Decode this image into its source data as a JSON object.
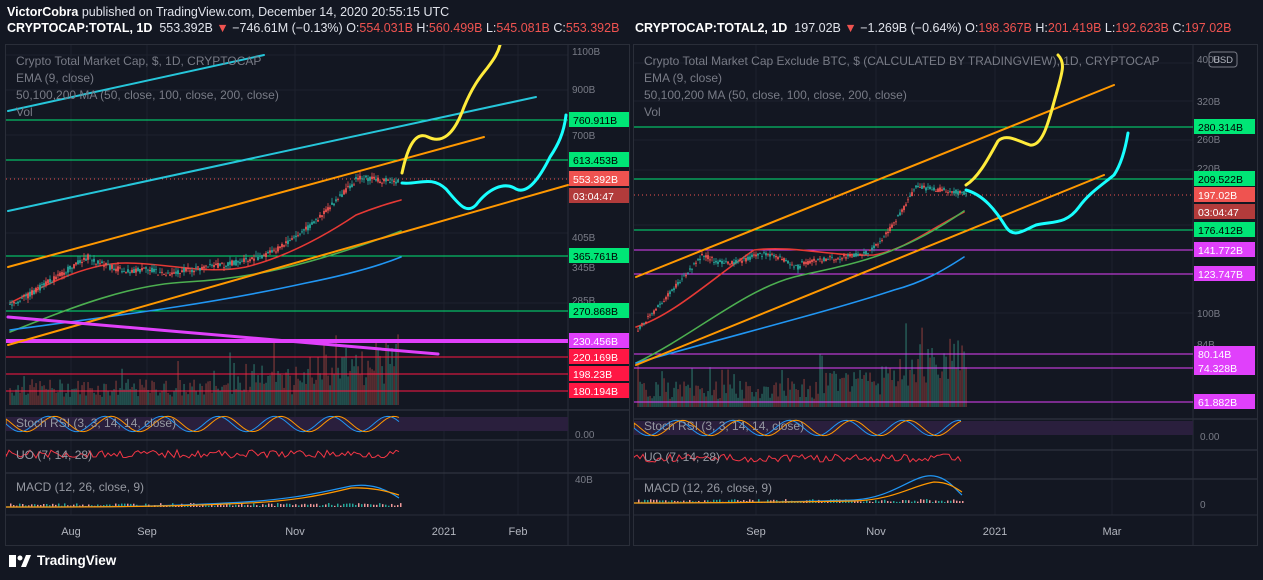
{
  "header": {
    "author": "VictorCobra",
    "published": "published on TradingView.com, December 14, 2020 20:55:15 UTC"
  },
  "left_symbol": {
    "ticker": "CRYPTOCAP:TOTAL, 1D",
    "price": "553.392B",
    "change": "−746.61M (−0.13%)",
    "o": "554.031B",
    "h": "560.499B",
    "l": "545.081B",
    "c": "553.392B"
  },
  "right_symbol": {
    "ticker": "CRYPTOCAP:TOTAL2, 1D",
    "price": "197.02B",
    "change": "−1.269B (−0.64%)",
    "o": "198.367B",
    "h": "201.419B",
    "l": "192.623B",
    "c": "197.02B"
  },
  "labels": {
    "o": "O:",
    "h": "H:",
    "l": "L:",
    "c": "C:",
    "usd": "USD",
    "brand": "TradingView"
  },
  "colors": {
    "background": "#131722",
    "up": "#26a69a",
    "down": "#ef5350",
    "ema": "#e53935",
    "ma50": "#4caf50",
    "ma100": "#8bc34a",
    "ma200": "#2196f3",
    "channel_orange": "#ff9800",
    "channel_cyan": "#26c6da",
    "projection_yellow": "#ffeb3b",
    "projection_cyan": "#18ffff",
    "level_green": "#00e676",
    "level_magenta": "#e040fb",
    "level_red": "#ff1744"
  },
  "chart_data": [
    {
      "type": "candlestick",
      "title": "Crypto Total Market Cap, $, 1D, CRYPTOCAP",
      "indicators": [
        "EMA (9, close)",
        "50,100,200 MA (50, close, 100, close, 200, close)",
        "Vol"
      ],
      "x_ticks": [
        "Aug",
        "Sep",
        "Nov",
        "2021",
        "Feb"
      ],
      "y_scale": "log",
      "y_ticks": [
        "1100B",
        "900B",
        "700B",
        "405B",
        "345B",
        "285B"
      ],
      "last_price": "553.392B",
      "countdown": "03:04:47",
      "levels": [
        {
          "label": "760.911B",
          "kind": "green"
        },
        {
          "label": "613.453B",
          "kind": "green"
        },
        {
          "label": "365.761B",
          "kind": "green"
        },
        {
          "label": "270.868B",
          "kind": "green"
        },
        {
          "label": "230.456B",
          "kind": "magenta"
        },
        {
          "label": "220.169B",
          "kind": "red"
        },
        {
          "label": "198.23B",
          "kind": "red"
        },
        {
          "label": "180.194B",
          "kind": "red"
        }
      ],
      "sub_indicators": [
        {
          "name": "Stoch RSI (3, 3, 14, 14, close)",
          "axis": "0.00"
        },
        {
          "name": "UO (7, 14, 28)",
          "axis": ""
        },
        {
          "name": "MACD (12, 26, close, 9)",
          "axis": "40B"
        }
      ]
    },
    {
      "type": "candlestick",
      "title": "Crypto Total Market Cap Exclude BTC, $ (CALCULATED BY TRADINGVIEW), 1D, CRYPTOCAP",
      "indicators": [
        "EMA (9, close)",
        "50,100,200 MA (50, close, 100, close, 200, close)",
        "Vol"
      ],
      "x_ticks": [
        "Sep",
        "Nov",
        "2021",
        "Mar"
      ],
      "y_scale": "log",
      "y_ticks": [
        "400B",
        "320B",
        "260B",
        "220B",
        "100B",
        "84B"
      ],
      "last_price": "197.02B",
      "countdown": "03:04:47",
      "levels": [
        {
          "label": "280.314B",
          "kind": "green"
        },
        {
          "label": "209.522B",
          "kind": "green"
        },
        {
          "label": "176.412B",
          "kind": "green"
        },
        {
          "label": "141.772B",
          "kind": "magenta"
        },
        {
          "label": "123.747B",
          "kind": "magenta"
        },
        {
          "label": "80.14B",
          "kind": "magenta"
        },
        {
          "label": "74.328B",
          "kind": "magenta"
        },
        {
          "label": "61.882B",
          "kind": "magenta"
        }
      ],
      "sub_indicators": [
        {
          "name": "Stoch RSI (3, 3, 14, 14, close)",
          "axis": "0.00"
        },
        {
          "name": "UO (7, 14, 28)",
          "axis": ""
        },
        {
          "name": "MACD (12, 26, close, 9)",
          "axis": "0"
        }
      ]
    }
  ]
}
